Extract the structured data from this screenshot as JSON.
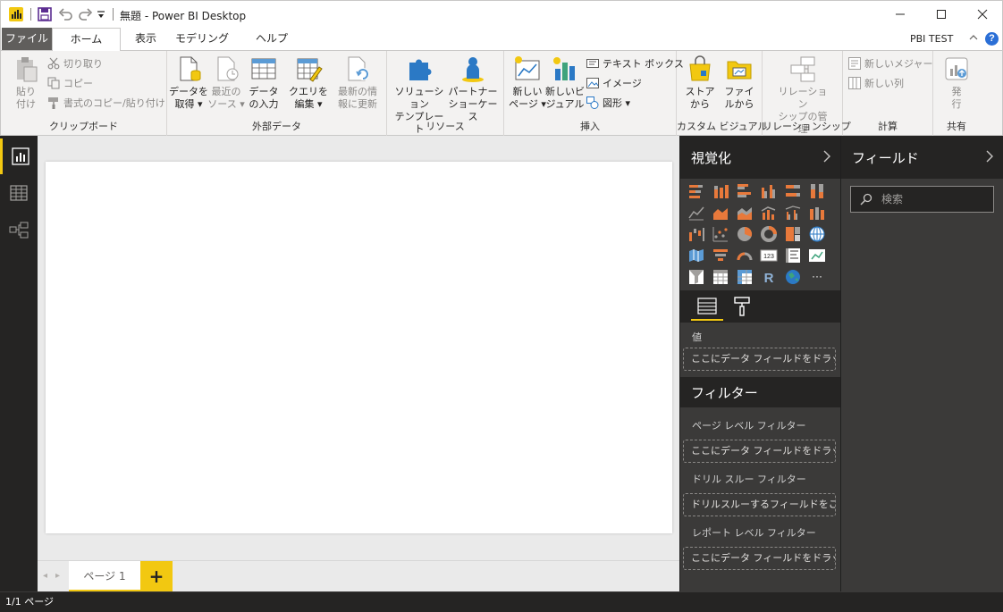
{
  "window": {
    "title": "無題 - Power BI Desktop",
    "account": "PBI TEST",
    "help": "?"
  },
  "tabs": [
    {
      "label": "ファイル"
    },
    {
      "label": "ホーム"
    },
    {
      "label": "表示"
    },
    {
      "label": "モデリング"
    },
    {
      "label": "ヘルプ"
    }
  ],
  "ribbon": {
    "clipboard": {
      "label": "クリップボード",
      "paste": "貼り\n付け",
      "cut": "切り取り",
      "copy": "コピー",
      "format_painter": "書式のコピー/貼り付け"
    },
    "external_data": {
      "label": "外部データ",
      "get_data": "データを\n取得 ▾",
      "recent_sources": "最近の\nソース ▾",
      "enter_data": "データ\nの入力",
      "edit_queries": "クエリを\n編集 ▾",
      "refresh": "最新の情\n報に更新"
    },
    "resources": {
      "label": "リソース",
      "solution_templates": "ソリューション\nテンプレート",
      "partner_showcase": "パートナー\nショーケース"
    },
    "insert": {
      "label": "挿入",
      "new_page": "新しい\nページ ▾",
      "new_visual": "新しいビ\nジュアル",
      "text_box": "テキスト ボックス",
      "image": "イメージ",
      "shapes": "図形 ▾"
    },
    "custom_visuals": {
      "label": "カスタム ビジュアル",
      "from_store": "ストア\nから",
      "from_file": "ファイ\nルから"
    },
    "relationships": {
      "label": "リレーションシップ",
      "manage": "リレーション\nシップの管理"
    },
    "calculations": {
      "label": "計算",
      "new_measure": "新しいメジャー",
      "new_column": "新しい列"
    },
    "share": {
      "label": "共有",
      "publish": "発\n行"
    }
  },
  "canvas": {
    "page_tab": "ページ 1",
    "add_page": "+"
  },
  "status": {
    "page_count": "1/1 ページ"
  },
  "viz_pane": {
    "title": "視覚化",
    "values_label": "値",
    "values_drop": "ここにデータ フィールドをドラッグし...",
    "filters_title": "フィルター",
    "page_filter_label": "ページ レベル フィルター",
    "page_filter_drop": "ここにデータ フィールドをドラッグ...",
    "drill_filter_label": "ドリル スルー フィルター",
    "drill_filter_drop": "ドリルスルーするフィールドをここ...",
    "report_filter_label": "レポート レベル フィルター",
    "report_filter_drop": "ここにデータ フィールドをドラッグ...",
    "r_icon": "R",
    "card_icon": "123",
    "more_icon": "···"
  },
  "fields_pane": {
    "title": "フィールド",
    "search_placeholder": "検索"
  }
}
